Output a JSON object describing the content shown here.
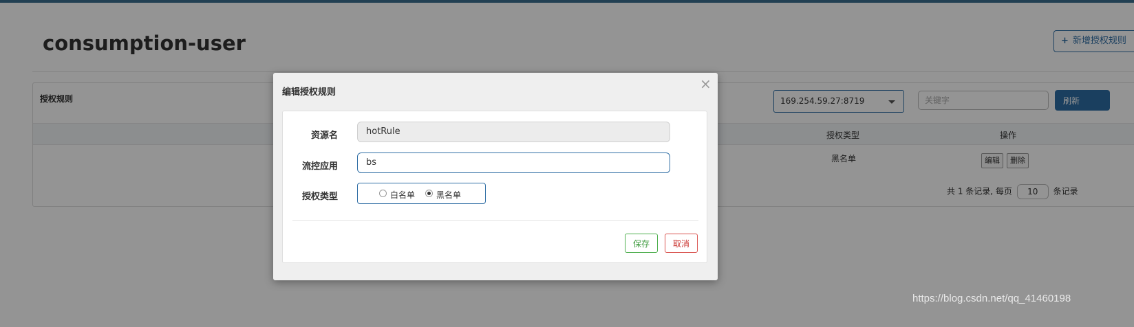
{
  "page": {
    "title": "consumption-user",
    "add_rule_button": "新增授权规则",
    "add_rule_icon": "plus-icon"
  },
  "panel": {
    "title": "授权规则",
    "machine_selected": "169.254.59.27:8719",
    "keyword_placeholder": "关键字",
    "refresh_button": "刷新",
    "table": {
      "columns": [
        "授权类型",
        "操作"
      ],
      "rows": [
        {
          "type": "黑名单",
          "edit": "编辑",
          "delete": "删除"
        }
      ]
    },
    "pagination": {
      "total_prefix": "共 1 条记录, 每页",
      "page_size": "10",
      "suffix": "条记录"
    }
  },
  "modal": {
    "title": "编辑授权规则",
    "close_icon": "close-icon",
    "fields": {
      "resource_label": "资源名",
      "resource_value": "hotRule",
      "app_label": "流控应用",
      "app_value": "bs",
      "type_label": "授权类型",
      "options": [
        {
          "label": "白名单",
          "checked": false
        },
        {
          "label": "黑名单",
          "checked": true
        }
      ]
    },
    "save_button": "保存",
    "cancel_button": "取消"
  },
  "watermark": "https://blog.csdn.net/qq_41460198",
  "colors": {
    "primary": "#2e6da4",
    "save": "#4cae4c",
    "cancel": "#d9534f",
    "backdrop": "#000000"
  }
}
